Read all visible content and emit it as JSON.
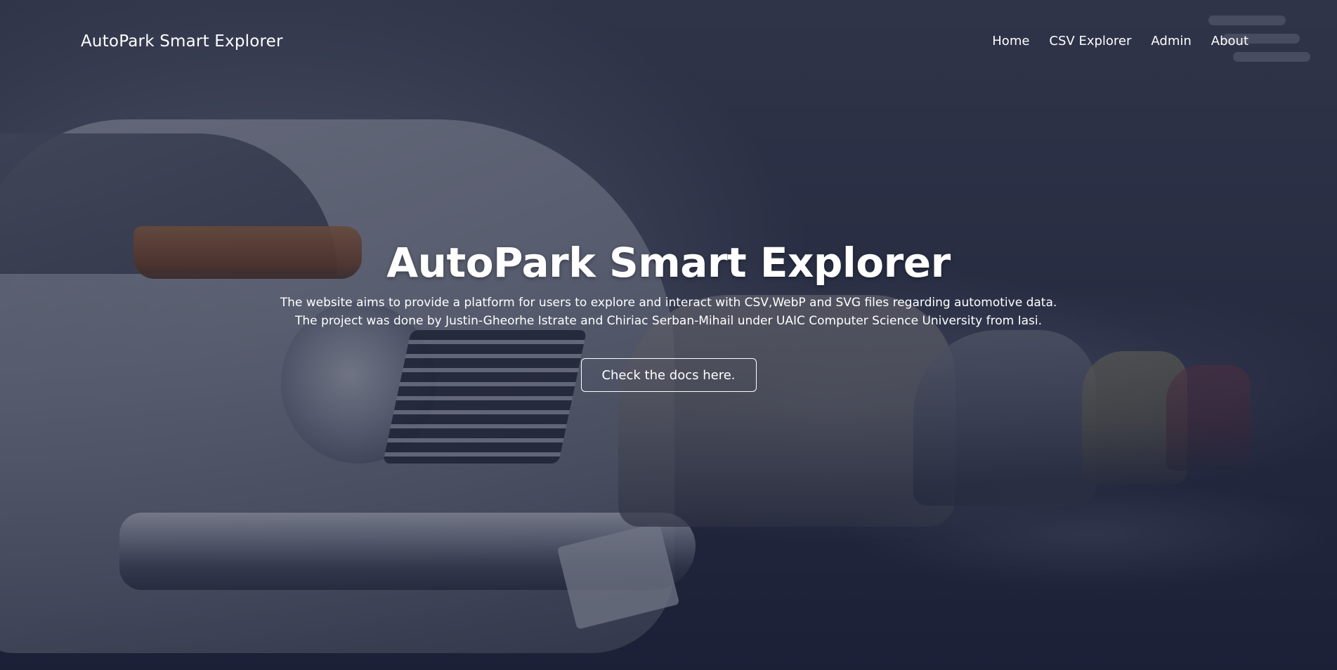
{
  "navbar": {
    "brand": "AutoPark Smart Explorer",
    "links": [
      {
        "label": "Home"
      },
      {
        "label": "CSV Explorer"
      },
      {
        "label": "Admin"
      },
      {
        "label": "About"
      }
    ]
  },
  "hero": {
    "title": "AutoPark Smart Explorer",
    "description_line1": "The website aims to provide a platform for users to explore and interact with CSV,WebP and SVG files regarding automotive data.",
    "description_line2": "The project was done by Justin-Gheorhe Istrate and Chiriac Serban-Mihail under UAIC Computer Science University from Iasi.",
    "cta_label": "Check the docs here."
  },
  "colors": {
    "overlay": "#1c203a",
    "text": "#ffffff"
  }
}
